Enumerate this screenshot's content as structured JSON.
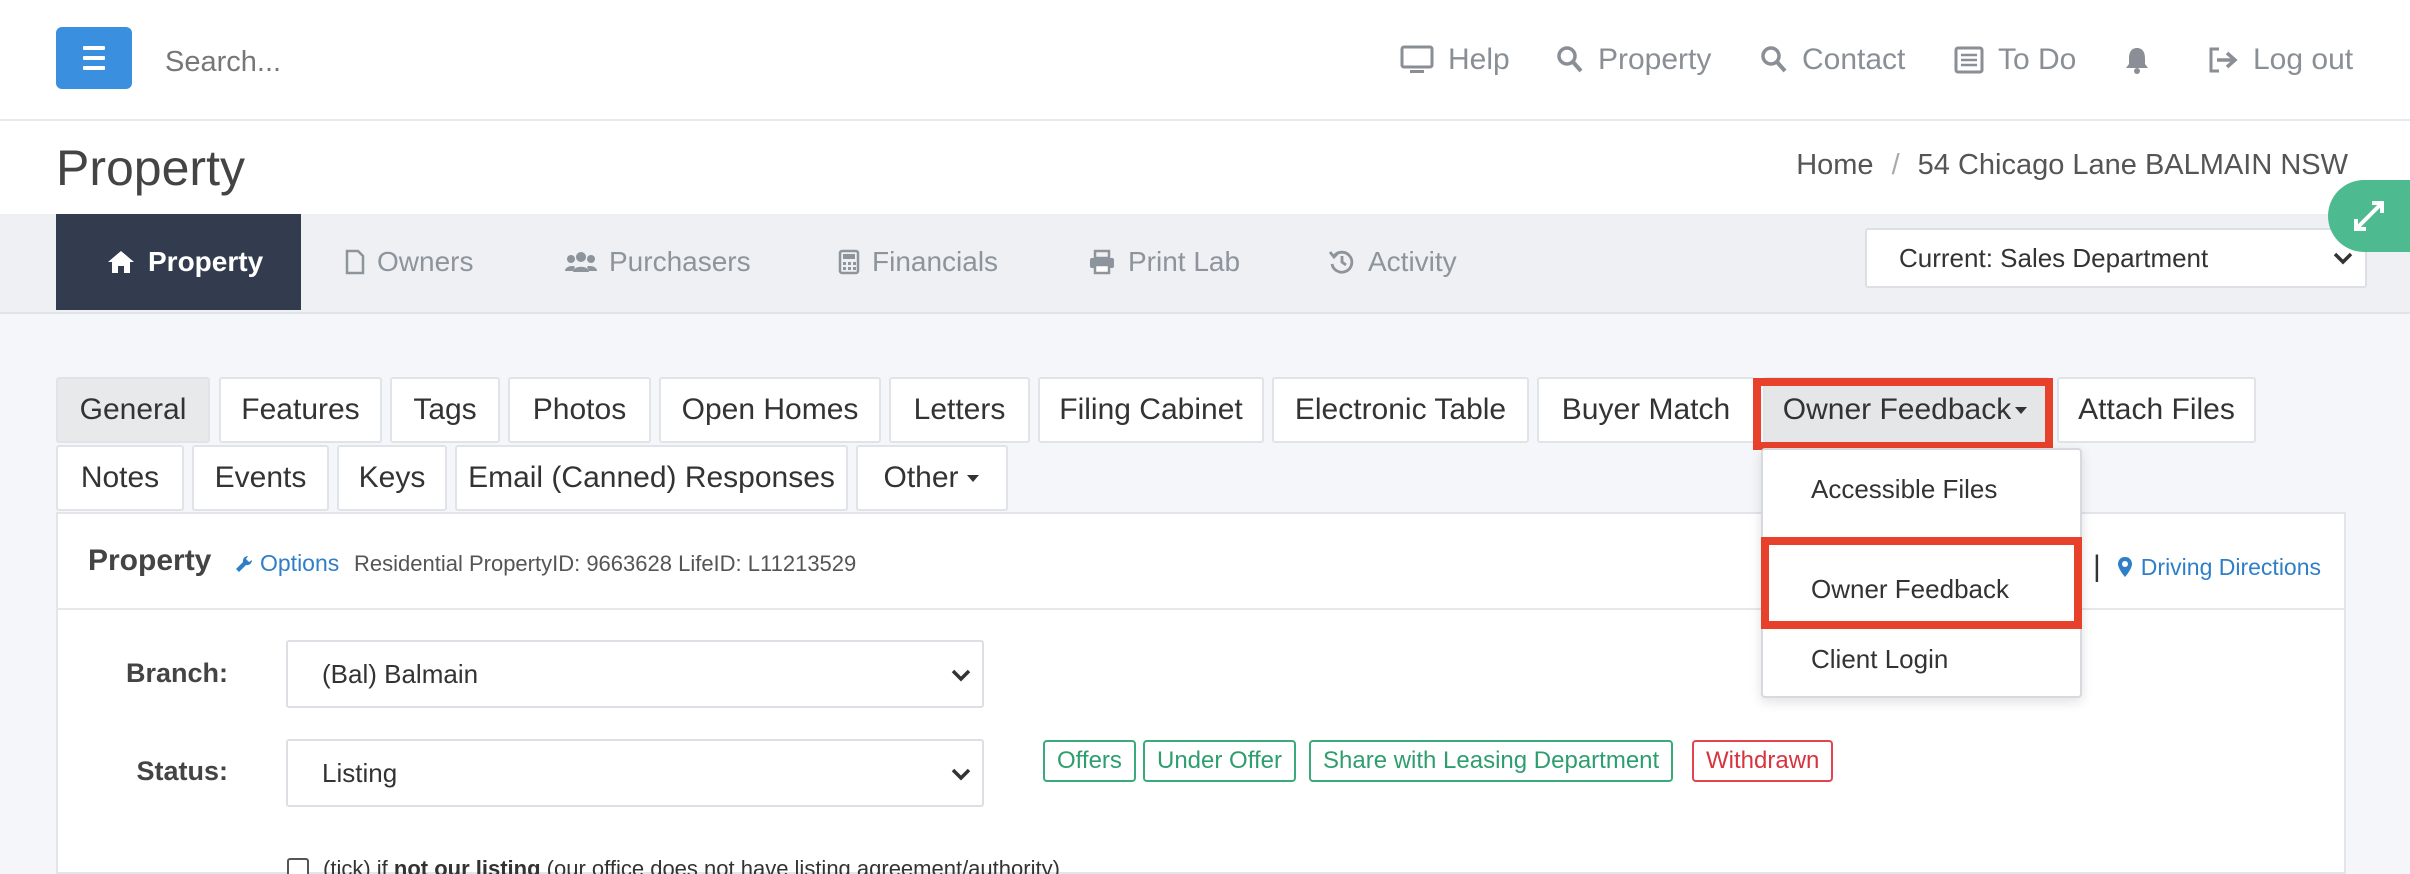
{
  "topbar": {
    "search_placeholder": "Search...",
    "nav": [
      {
        "label": "Help",
        "icon": "monitor-icon"
      },
      {
        "label": "Property",
        "icon": "search-icon"
      },
      {
        "label": "Contact",
        "icon": "search-icon"
      },
      {
        "label": "To Do",
        "icon": "list-icon"
      },
      {
        "label": "",
        "icon": "bell-icon"
      },
      {
        "label": "Log out",
        "icon": "logout-icon"
      }
    ]
  },
  "page": {
    "title": "Property",
    "breadcrumb": [
      "Home",
      "/",
      "54 Chicago Lane BALMAIN NSW"
    ]
  },
  "main_tabs": [
    {
      "label": "Property",
      "icon": "home-icon",
      "active": true
    },
    {
      "label": "Owners",
      "icon": "file-icon"
    },
    {
      "label": "Purchasers",
      "icon": "users-icon"
    },
    {
      "label": "Financials",
      "icon": "calculator-icon"
    },
    {
      "label": "Print Lab",
      "icon": "printer-icon"
    },
    {
      "label": "Activity",
      "icon": "history-icon"
    }
  ],
  "department": {
    "selected": "Current: Sales Department"
  },
  "sub_tabs_row1": [
    "General",
    "Features",
    "Tags",
    "Photos",
    "Open Homes",
    "Letters",
    "Filing Cabinet",
    "Electronic Table",
    "Buyer Match",
    "Owner Feedback",
    "Attach Files"
  ],
  "sub_tabs_row2": [
    "Notes",
    "Events",
    "Keys",
    "Email (Canned) Responses",
    "Other"
  ],
  "dropdown": {
    "items": [
      "Accessible Files",
      "Owner Feedback",
      "Client Login"
    ]
  },
  "panel": {
    "title": "Property",
    "options_label": "Options",
    "ids_text": "Residential PropertyID: 9663628  LifeID: L11213529",
    "pipe": "|",
    "directions_label": "Driving Directions",
    "branch_label": "Branch:",
    "branch_value": "(Bal) Balmain",
    "status_label": "Status:",
    "status_value": "Listing",
    "status_tags": [
      {
        "label": "Offers",
        "color": "#2f9e6e"
      },
      {
        "label": "Under Offer",
        "color": "#2f9e6e"
      },
      {
        "label": "Share with Leasing Department",
        "color": "#2f9e6e"
      },
      {
        "label": "Withdrawn",
        "color": "#d7343f"
      }
    ],
    "checkbox_pre": "(tick) if",
    "checkbox_bold": "not our listing",
    "checkbox_post": "(our office does not have listing agreement/authority)"
  },
  "colors": {
    "accent_blue": "#3a8fde",
    "dark_tab": "#333c4e",
    "highlight_red": "#e8412b",
    "expand_green": "#4dba8f"
  }
}
